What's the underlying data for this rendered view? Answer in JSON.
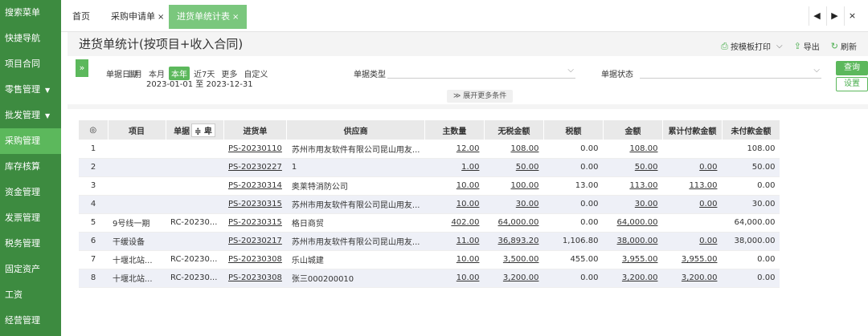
{
  "sidebar": {
    "items": [
      {
        "label": "搜索菜单",
        "arrow": false
      },
      {
        "label": "快捷导航",
        "arrow": false
      },
      {
        "label": "项目合同",
        "arrow": false
      },
      {
        "label": "零售管理",
        "arrow": true
      },
      {
        "label": "批发管理",
        "arrow": true
      },
      {
        "label": "采购管理",
        "arrow": false,
        "active": true
      },
      {
        "label": "库存核算",
        "arrow": false
      },
      {
        "label": "资金管理",
        "arrow": false
      },
      {
        "label": "发票管理",
        "arrow": false
      },
      {
        "label": "税务管理",
        "arrow": false
      },
      {
        "label": "固定资产",
        "arrow": false
      },
      {
        "label": "工资",
        "arrow": false
      },
      {
        "label": "经营管理",
        "arrow": false
      }
    ],
    "arrow_glyph": "▼"
  },
  "tabs": {
    "home": "首页",
    "purchase_request": "采购申请单",
    "receipt_stats": "进货单统计表",
    "close_glyph": "×",
    "nav_prev": "◀",
    "nav_next": "▶",
    "nav_close": "×"
  },
  "page": {
    "title": "进货单统计(按项目+收入合同)",
    "toolbar": {
      "print": "按模板打印",
      "print_more": "⌵",
      "export": "导出",
      "refresh": "刷新"
    }
  },
  "filter": {
    "expand_glyph": "»",
    "date_label": "单据日期",
    "date_options": [
      "上月",
      "本月",
      "本年",
      "近7天",
      "更多",
      "自定义"
    ],
    "date_active": "本年",
    "date_range": "2023-01-01 至 2023-12-31",
    "type_label": "单据类型",
    "status_label": "单据状态",
    "more_conditions": "≫ 展开更多条件",
    "query": "查询",
    "settings": "设置"
  },
  "table": {
    "headers": [
      "◎",
      "项目",
      "单据",
      "进货单",
      "供应商",
      "主数量",
      "无税金额",
      "税额",
      "金额",
      "累计付款金额",
      "未付款金额"
    ],
    "sort_icon": "≑ 卑",
    "rows": [
      {
        "no": "1",
        "project": "",
        "contract": "",
        "doc": "PS-20230110",
        "supplier": "苏州市用友软件有限公司昆山用友...",
        "qty": "12.00",
        "net": "108.00",
        "tax": "0.00",
        "amount": "108.00",
        "paid": "",
        "unpaid": "108.00"
      },
      {
        "no": "2",
        "project": "",
        "contract": "",
        "doc": "PS-20230227",
        "supplier": "1",
        "qty": "1.00",
        "net": "50.00",
        "tax": "0.00",
        "amount": "50.00",
        "paid": "0.00",
        "unpaid": "50.00"
      },
      {
        "no": "3",
        "project": "",
        "contract": "",
        "doc": "PS-20230314",
        "supplier": "奥莱特消防公司",
        "qty": "10.00",
        "net": "100.00",
        "tax": "13.00",
        "amount": "113.00",
        "paid": "113.00",
        "unpaid": "0.00"
      },
      {
        "no": "4",
        "project": "",
        "contract": "",
        "doc": "PS-20230315",
        "supplier": "苏州市用友软件有限公司昆山用友...",
        "qty": "10.00",
        "net": "30.00",
        "tax": "0.00",
        "amount": "30.00",
        "paid": "0.00",
        "unpaid": "30.00"
      },
      {
        "no": "5",
        "project": "9号线一期",
        "contract": "RC-20230...",
        "doc": "PS-20230315",
        "supplier": "格日商贸",
        "qty": "402.00",
        "net": "64,000.00",
        "tax": "0.00",
        "amount": "64,000.00",
        "paid": "",
        "unpaid": "64,000.00"
      },
      {
        "no": "6",
        "project": "干缓设备",
        "contract": "",
        "doc": "PS-20230217",
        "supplier": "苏州市用友软件有限公司昆山用友...",
        "qty": "11.00",
        "net": "36,893.20",
        "tax": "1,106.80",
        "amount": "38,000.00",
        "paid": "0.00",
        "unpaid": "38,000.00"
      },
      {
        "no": "7",
        "project": "十堰北站...",
        "contract": "RC-20230...",
        "doc": "PS-20230308",
        "supplier": "乐山城建",
        "qty": "10.00",
        "net": "3,500.00",
        "tax": "455.00",
        "amount": "3,955.00",
        "paid": "3,955.00",
        "unpaid": "0.00"
      },
      {
        "no": "8",
        "project": "十堰北站...",
        "contract": "RC-20230...",
        "doc": "PS-20230308",
        "supplier": "张三000200010",
        "qty": "10.00",
        "net": "3,200.00",
        "tax": "0.00",
        "amount": "3,200.00",
        "paid": "3,200.00",
        "unpaid": "0.00"
      }
    ]
  }
}
